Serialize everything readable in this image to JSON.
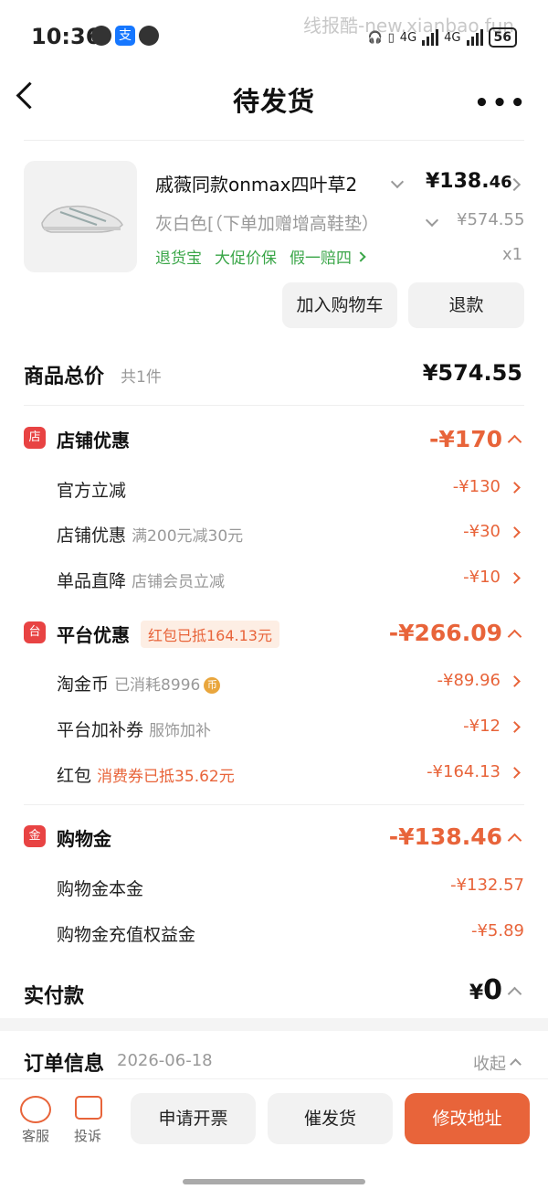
{
  "status": {
    "time": "10:36",
    "watermark": "线报酷-new.xianbao.fun",
    "net1": "4G",
    "net2": "4G",
    "battery": "56"
  },
  "header": {
    "title": "待发货"
  },
  "product": {
    "name": "戚薇同款onmax四叶草2",
    "price_main": "¥138.",
    "price_dec": "46",
    "variant": "灰白色[（下单加赠增高鞋垫）",
    "original_price": "¥574.55",
    "tags": [
      "退货宝",
      "大促价保",
      "假一赔四"
    ],
    "qty": "x1",
    "btn_cart": "加入购物车",
    "btn_refund": "退款"
  },
  "summary": {
    "label": "商品总价",
    "count": "共1件",
    "value": "¥574.55"
  },
  "store_discount": {
    "icon": "店",
    "title": "店铺优惠",
    "value": "-¥170",
    "items": [
      {
        "label": "官方立减",
        "sub": "",
        "value": "-¥130"
      },
      {
        "label": "店铺优惠",
        "sub": "满200元减30元",
        "value": "-¥30"
      },
      {
        "label": "单品直降",
        "sub": "店铺会员立减",
        "value": "-¥10"
      }
    ]
  },
  "platform_discount": {
    "icon": "台",
    "title": "平台优惠",
    "pill": "红包已抵164.13元",
    "value": "-¥266.09",
    "items": [
      {
        "label": "淘金币",
        "sub": "已消耗8996",
        "coin": "币",
        "value": "-¥89.96"
      },
      {
        "label": "平台加补券",
        "sub": "服饰加补",
        "value": "-¥12"
      },
      {
        "label": "红包",
        "sub": "消费券已抵35.62元",
        "value": "-¥164.13"
      }
    ]
  },
  "shopping_gold": {
    "icon": "金",
    "title": "购物金",
    "value": "-¥138.46",
    "items": [
      {
        "label": "购物金本金",
        "value": "-¥132.57"
      },
      {
        "label": "购物金充值权益金",
        "value": "-¥5.89"
      }
    ]
  },
  "paid": {
    "label": "实付款",
    "currency": "¥",
    "value": "0"
  },
  "order_info": {
    "label": "订单信息",
    "date": "2026-06-18",
    "collapse": "收起"
  },
  "bottom": {
    "service": "客服",
    "complaint": "投诉",
    "invoice": "申请开票",
    "urge": "催发货",
    "address": "修改地址"
  },
  "colors": {
    "accent": "#e8643a",
    "green": "#3aa648",
    "red_icon": "#e84343"
  }
}
